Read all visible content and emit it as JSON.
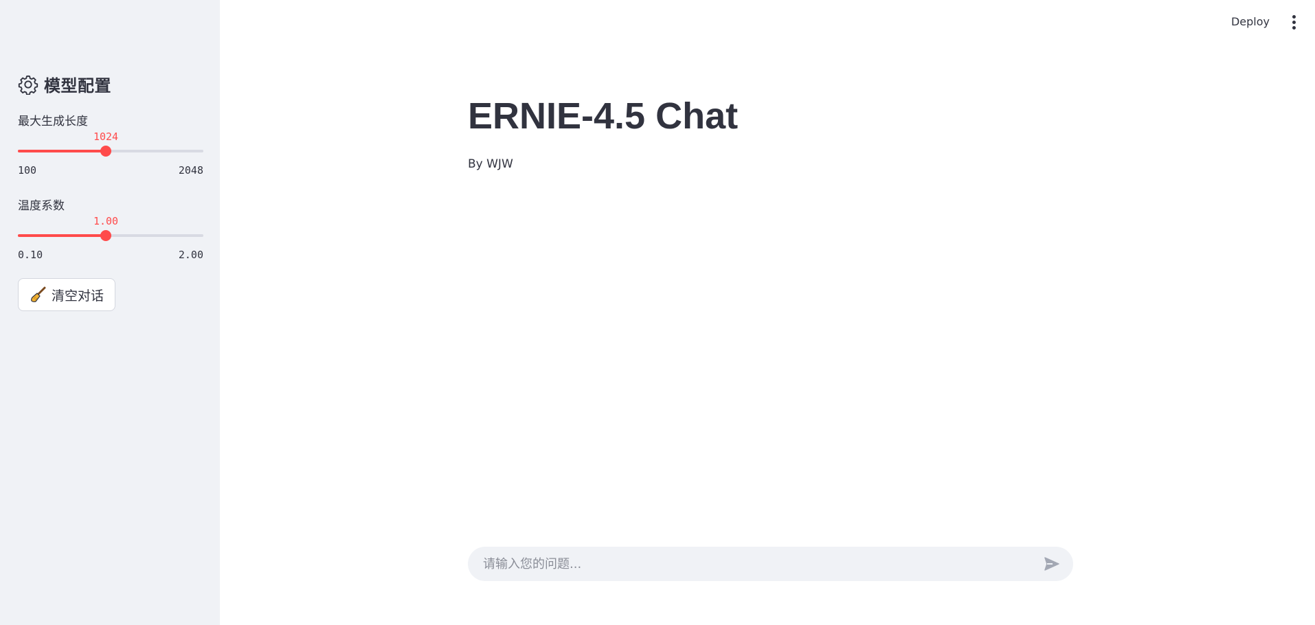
{
  "topbar": {
    "deploy_label": "Deploy",
    "menu_icon": "kebab-menu-icon"
  },
  "sidebar": {
    "icon": "gear-icon",
    "title": "模型配置",
    "sliders": [
      {
        "label": "最大生成长度",
        "value": "1024",
        "min": "100",
        "max": "2048",
        "fraction": 0.474
      },
      {
        "label": "温度系数",
        "value": "1.00",
        "min": "0.10",
        "max": "2.00",
        "fraction": 0.474
      }
    ],
    "clear_button": {
      "icon": "broom-icon",
      "label": "清空对话"
    }
  },
  "main": {
    "title": "ERNIE-4.5 Chat",
    "byline": "By WJW"
  },
  "chat": {
    "placeholder": "请输入您的问题...",
    "value": "",
    "send_icon": "send-icon"
  },
  "colors": {
    "accent": "#ff4b4b",
    "sidebar_bg": "#f0f2f6",
    "text": "#31333f"
  }
}
